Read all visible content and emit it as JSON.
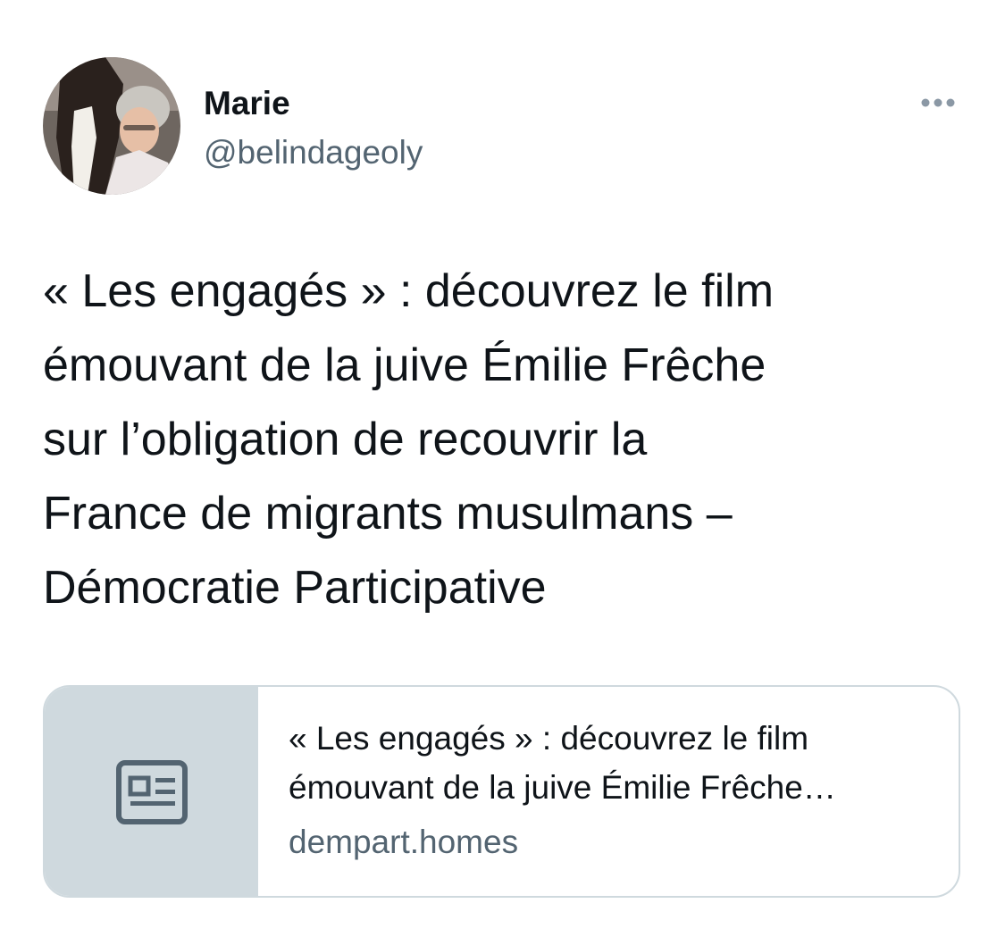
{
  "tweet": {
    "author": {
      "name": "Marie",
      "handle": "@belindageoly"
    },
    "text": "« Les engagés » : découvrez le film\némouvant de la juive Émilie Frêche\nsur l’obligation de recouvrir la\nFrance de migrants musulmans –\nDémocratie Participative",
    "card": {
      "title": "« Les engagés » : découvrez le film\némouvant de la juive Émilie Frêche…",
      "domain": "dempart.homes",
      "thumbnail_icon": "article-icon"
    }
  },
  "icons": {
    "more": "more-options-icon",
    "card": "article-icon"
  },
  "colors": {
    "text": "#0f1419",
    "secondary": "#536471",
    "border": "#cfd9de",
    "thumbnail_bg": "#cfd9de"
  }
}
